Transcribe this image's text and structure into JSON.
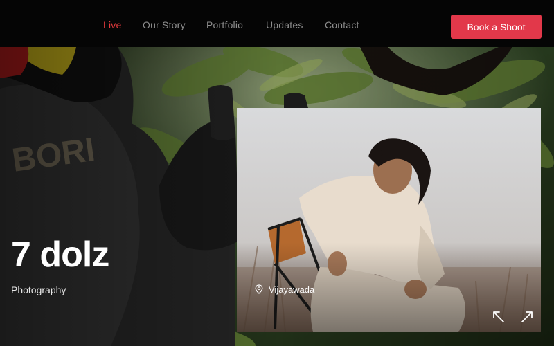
{
  "nav": {
    "items": [
      {
        "label": "Live",
        "active": true
      },
      {
        "label": "Our Story",
        "active": false
      },
      {
        "label": "Portfolio",
        "active": false
      },
      {
        "label": "Updates",
        "active": false
      },
      {
        "label": "Contact",
        "active": false
      }
    ],
    "cta_label": "Book a Shoot"
  },
  "hero": {
    "title": "7 dolz",
    "subtitle": "Photography"
  },
  "card": {
    "location": "Vijayawada",
    "location_icon": "map-pin-icon",
    "prev_icon": "arrow-up-left-icon",
    "next_icon": "arrow-up-right-icon"
  },
  "colors": {
    "accent": "#e2384a",
    "nav_active": "#e23a3d",
    "nav_inactive": "#8e8e8e",
    "topbar_bg": "#050505"
  }
}
